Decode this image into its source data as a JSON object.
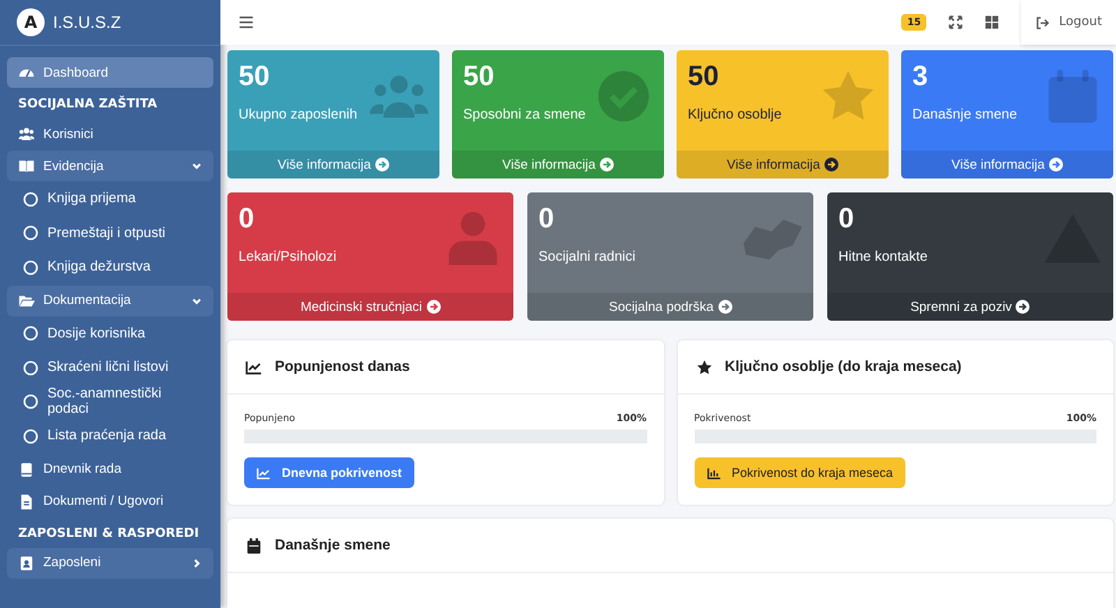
{
  "brand": {
    "logo_letter": "A",
    "name": "I.S.U.S.Z"
  },
  "sidebar": {
    "items": [
      {
        "kind": "link",
        "label": "Dashboard",
        "selected": true
      },
      {
        "kind": "header",
        "label": "SOCIJALNA ZAŠTITA"
      },
      {
        "kind": "link",
        "label": "Korisnici",
        "selected": false
      },
      {
        "kind": "group",
        "label": "Evidencija",
        "expanded": true
      },
      {
        "kind": "sub",
        "label": "Knjiga prijema",
        "selected": false
      },
      {
        "kind": "sub",
        "label": "Premeštaji i otpusti",
        "selected": false
      },
      {
        "kind": "sub",
        "label": "Knjiga dežurstva",
        "selected": false
      },
      {
        "kind": "group",
        "label": "Dokumentacija",
        "expanded": true
      },
      {
        "kind": "sub",
        "label": "Dosije korisnika",
        "selected": false
      },
      {
        "kind": "sub",
        "label": "Skraćeni lični listovi",
        "selected": false
      },
      {
        "kind": "sub",
        "label": "Soc.-anamnestički podaci",
        "selected": false
      },
      {
        "kind": "sub",
        "label": "Lista praćenja rada",
        "selected": false
      },
      {
        "kind": "link",
        "label": "Dnevnik rada",
        "selected": false
      },
      {
        "kind": "link",
        "label": "Dokumenti / Ugovori",
        "selected": false
      },
      {
        "kind": "header",
        "label": "ZAPOSLENI & RASPOREDI"
      },
      {
        "kind": "group",
        "label": "Zaposleni",
        "expanded": false
      }
    ]
  },
  "topbar": {
    "badge": "15",
    "logout": "Logout"
  },
  "stat_rows": [
    [
      {
        "value": "50",
        "label": "Ukupno zaposlenih",
        "link": "Više informacija",
        "color": "#3aa0b8"
      },
      {
        "value": "50",
        "label": "Sposobni za smene",
        "link": "Više informacija",
        "color": "#3aa449"
      },
      {
        "value": "50",
        "label": "Ključno osoblje",
        "link": "Više informacija",
        "color": "#f7c12a"
      },
      {
        "value": "3",
        "label": "Današnje smene",
        "link": "Više informacija",
        "color": "#3b7af5"
      }
    ],
    [
      {
        "value": "0",
        "label": "Lekari/Psiholozi",
        "link": "Medicinski stručnjaci",
        "color": "#d63c48"
      },
      {
        "value": "0",
        "label": "Socijalni radnici",
        "link": "Socijalna podrška",
        "color": "#6c757d"
      },
      {
        "value": "0",
        "label": "Hitne kontakte",
        "link": "Spremni za poziv",
        "color": "#343a40"
      }
    ]
  ],
  "panels": [
    {
      "title": "Popunjenost danas",
      "bar_label": "Popunjeno",
      "reading": "100%",
      "level": 0,
      "button": "Dnevna pokrivenost",
      "kind": "primary"
    },
    {
      "title": "Ključno osoblje (do kraja meseca)",
      "bar_label": "Pokrivenost",
      "reading": "100%",
      "level": 0,
      "button": "Pokrivenost do kraja meseca",
      "kind": "warning"
    }
  ],
  "shifts_panel": {
    "title": "Današnje smene"
  }
}
